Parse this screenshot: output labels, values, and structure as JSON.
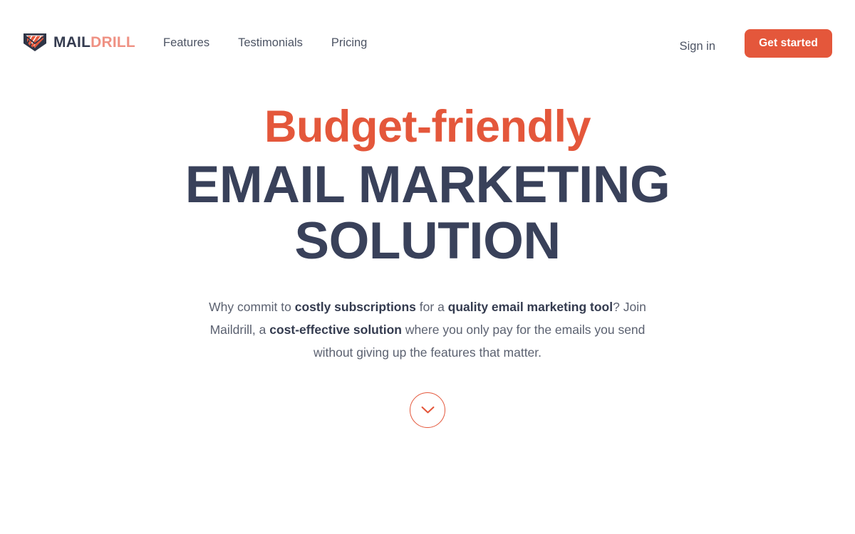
{
  "brand": {
    "name_part1": "MAIL",
    "name_part2": "DRILL",
    "logo_icon": "maildrill-shield-icon"
  },
  "nav": {
    "items": [
      {
        "label": "Features"
      },
      {
        "label": "Testimonials"
      },
      {
        "label": "Pricing"
      }
    ]
  },
  "header": {
    "signin_label": "Sign in",
    "cta_label": "Get started"
  },
  "hero": {
    "eyebrow": "Budget-friendly",
    "title": "EMAIL MARKETING SOLUTION",
    "paragraph": {
      "segment_1": "Why commit to ",
      "bold_1": "costly subscriptions",
      "segment_2": " for a ",
      "bold_2": "quality email marketing tool",
      "segment_3": "? Join Maildrill, a ",
      "bold_3": "cost-effective solution",
      "segment_4": " where you only pay for the emails you send without giving up the features that matter."
    },
    "scroll_icon": "chevron-down-icon"
  },
  "colors": {
    "accent": "#e4573b",
    "accent_light": "#ef9183",
    "heading": "#39415a",
    "body_text": "#5b6170",
    "nav_text": "#4d5464",
    "background": "#ffffff"
  }
}
